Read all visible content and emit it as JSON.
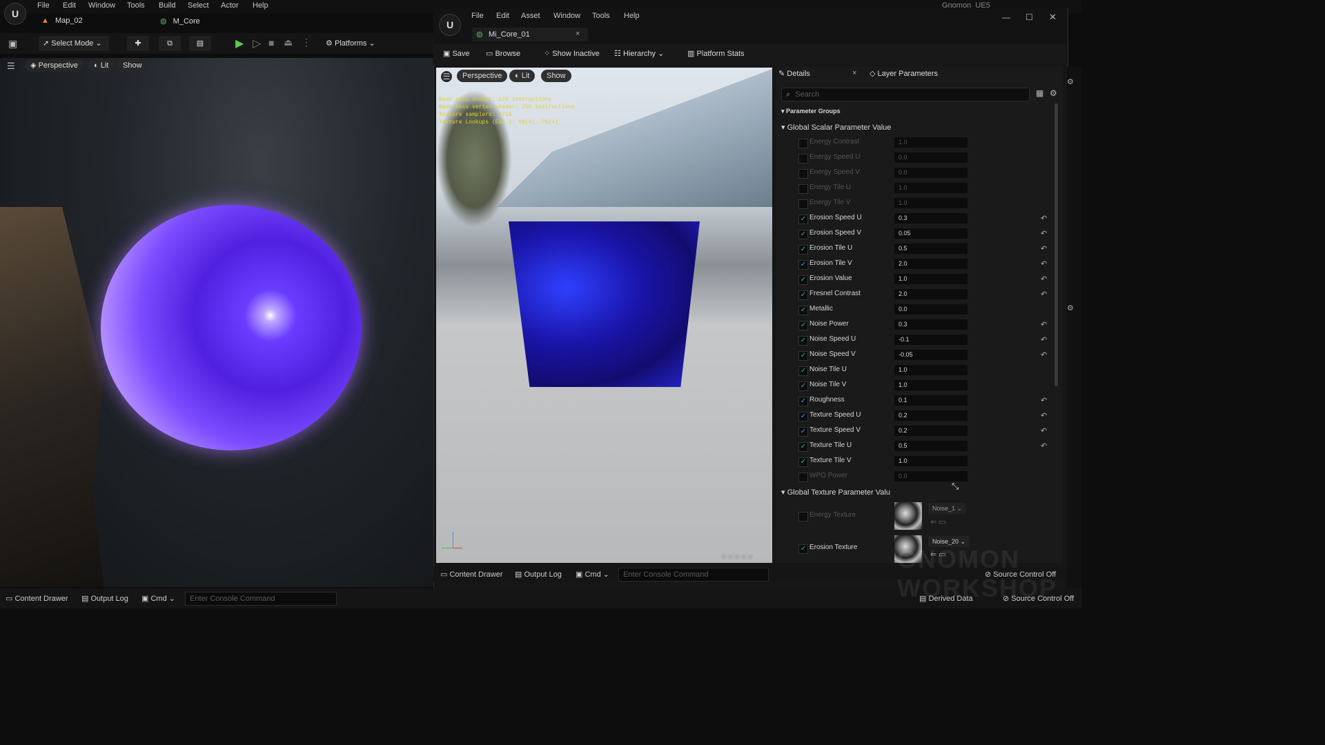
{
  "main_editor": {
    "menu": [
      "File",
      "Edit",
      "Window",
      "Tools",
      "Build",
      "Select",
      "Actor",
      "Help"
    ],
    "window_title": "Gnomon_UE5",
    "tabs": [
      {
        "label": "Map_02"
      },
      {
        "label": "M_Core"
      }
    ],
    "toolbar": {
      "select_mode": "Select Mode",
      "platforms": "Platforms"
    },
    "viewport": {
      "perspective": "Perspective",
      "lit": "Lit",
      "show": "Show"
    },
    "status": {
      "content_drawer": "Content Drawer",
      "output_log": "Output Log",
      "cmd": "Cmd",
      "console_placeholder": "Enter Console Command"
    }
  },
  "mi_window": {
    "menu": [
      "File",
      "Edit",
      "Asset",
      "Window",
      "Tools",
      "Help"
    ],
    "tab_label": "Mi_Core_01",
    "toolbar": {
      "save": "Save",
      "browse": "Browse",
      "show_inactive": "Show Inactive",
      "hierarchy": "Hierarchy",
      "platform_stats": "Platform Stats"
    },
    "viewport": {
      "perspective": "Perspective",
      "lit": "Lit",
      "show": "Show",
      "stats": [
        "Base pass shader: 178 instructions",
        "Base pass vertex shader: 255 instructions",
        "Texture samplers: 7/16",
        "Texture Lookups (Est.): VS(4), PS(4)"
      ]
    },
    "status": {
      "content_drawer": "Content Drawer",
      "output_log": "Output Log",
      "cmd": "Cmd",
      "console_placeholder": "Enter Console Command"
    }
  },
  "details": {
    "tab_details": "Details",
    "tab_layer": "Layer Parameters",
    "search_placeholder": "Search",
    "parameter_groups": "Parameter Groups",
    "scalar_group": "Global Scalar Parameter Value",
    "texture_group": "Global Texture Parameter Valu",
    "scalar_params": [
      {
        "name": "Energy Contrast",
        "value": "1.0",
        "enabled": false
      },
      {
        "name": "Energy Speed U",
        "value": "0.0",
        "enabled": false
      },
      {
        "name": "Energy Speed V",
        "value": "0.0",
        "enabled": false
      },
      {
        "name": "Energy Tile U",
        "value": "1.0",
        "enabled": false
      },
      {
        "name": "Energy Tile V",
        "value": "1.0",
        "enabled": false
      },
      {
        "name": "Erosion Speed U",
        "value": "0.3",
        "enabled": true
      },
      {
        "name": "Erosion Speed V",
        "value": "0.05",
        "enabled": true
      },
      {
        "name": "Erosion Tile U",
        "value": "0.5",
        "enabled": true
      },
      {
        "name": "Erosion Tile V",
        "value": "2.0",
        "enabled": true
      },
      {
        "name": "Erosion Value",
        "value": "1.0",
        "enabled": true
      },
      {
        "name": "Fresnel Contrast",
        "value": "2.0",
        "enabled": true
      },
      {
        "name": "Metallic",
        "value": "0.0",
        "enabled": true
      },
      {
        "name": "Noise Power",
        "value": "0.3",
        "enabled": true
      },
      {
        "name": "Noise Speed U",
        "value": "-0.1",
        "enabled": true
      },
      {
        "name": "Noise Speed V",
        "value": "-0.05",
        "enabled": true
      },
      {
        "name": "Noise Tile U",
        "value": "1.0",
        "enabled": true
      },
      {
        "name": "Noise Tile V",
        "value": "1.0",
        "enabled": true
      },
      {
        "name": "Roughness",
        "value": "0.1",
        "enabled": true
      },
      {
        "name": "Texture Speed U",
        "value": "0.2",
        "enabled": true
      },
      {
        "name": "Texture Speed V",
        "value": "0.2",
        "enabled": true
      },
      {
        "name": "Texture Tile U",
        "value": "0.5",
        "enabled": true
      },
      {
        "name": "Texture Tile V",
        "value": "1.0",
        "enabled": true
      },
      {
        "name": "WPO Power",
        "value": "0.0",
        "enabled": false
      }
    ],
    "texture_params": [
      {
        "name": "Energy Texture",
        "value": "Noise_1",
        "enabled": false
      },
      {
        "name": "Erosion Texture",
        "value": "Noise_20",
        "enabled": true
      }
    ]
  },
  "bottom_status": {
    "source_control_1": "Source Control Off",
    "derived_data": "Derived Data",
    "source_control_2": "Source Control Off"
  },
  "watermark": "GNOMON WORKSHOP"
}
